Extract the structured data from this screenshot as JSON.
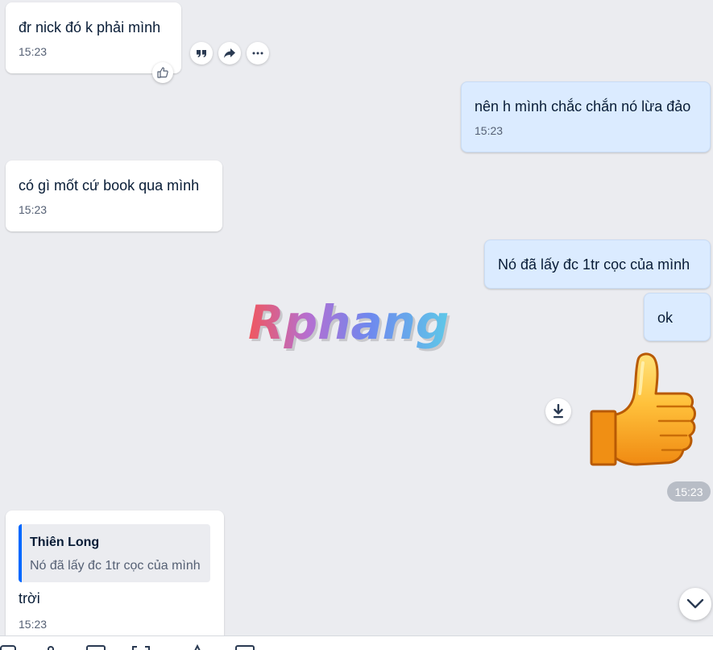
{
  "messages": [
    {
      "text": "đr nick đó k phải mình",
      "time": "15:23"
    },
    {
      "text": "nên h mình chắc chắn nó lừa đảo",
      "time": "15:23"
    },
    {
      "text": "có gì mốt cứ book qua mình",
      "time": "15:23"
    },
    {
      "text": "Nó đã lấy đc 1tr cọc của mình"
    },
    {
      "text": "ok"
    },
    {
      "sticker": "thumbs-up-sticker",
      "time": "15:23"
    },
    {
      "quote_name": "Thiên Long",
      "quote_text": "Nó đã lấy đc 1tr cọc của mình",
      "text": "trời",
      "time": "15:23"
    }
  ],
  "watermark": {
    "text": "Rphang"
  },
  "icons": {
    "reaction": "like-icon",
    "actions": [
      "quote-icon",
      "forward-icon",
      "more-icon"
    ],
    "download": "download-icon",
    "scroll": "chevron-down-icon"
  },
  "colors": {
    "background": "#ebecf0",
    "incoming_bubble": "#ffffff",
    "outgoing_bubble": "#dbebff",
    "accent": "#0068ff"
  }
}
